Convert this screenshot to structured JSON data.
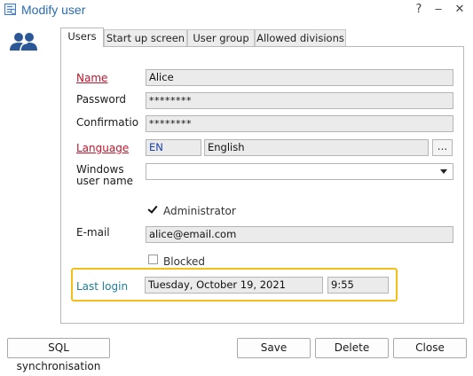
{
  "window": {
    "title": "Modify user",
    "help_label": "?",
    "minimize_label": "‒",
    "close_label": "✕"
  },
  "tabs": [
    {
      "label": "Users",
      "active": true
    },
    {
      "label": "Start up screen",
      "active": false
    },
    {
      "label": "User group",
      "active": false
    },
    {
      "label": "Allowed divisions",
      "active": false
    }
  ],
  "form": {
    "name": {
      "label": "Name",
      "value": "Alice"
    },
    "password": {
      "label": "Password",
      "value": "********"
    },
    "confirmation": {
      "label": "Confirmatio",
      "value": "********"
    },
    "language": {
      "label": "Language",
      "code": "EN",
      "name": "English",
      "browse_label": "..."
    },
    "windows_user": {
      "label_line1": "Windows",
      "label_line2": "user name",
      "value": ""
    },
    "administrator": {
      "label": "Administrator",
      "checked": true
    },
    "email": {
      "label": "E-mail",
      "value": "alice@email.com"
    },
    "blocked": {
      "label": "Blocked",
      "checked": false
    },
    "last_login": {
      "label": "Last login",
      "date": "Tuesday, October 19, 2021",
      "time": "9:55"
    }
  },
  "buttons": {
    "sql_sync": "SQL synchronisation",
    "save": "Save",
    "delete": "Delete",
    "close": "Close"
  },
  "colors": {
    "title": "#2b6cb0",
    "required_label": "#c0152b",
    "last_login_label": "#1f7e9a",
    "highlight": "#f2bf19",
    "icon": "#2b5797"
  },
  "icons": {
    "app": "user-form-icon",
    "users": "users-icon",
    "combo": "chevron-down-icon"
  }
}
